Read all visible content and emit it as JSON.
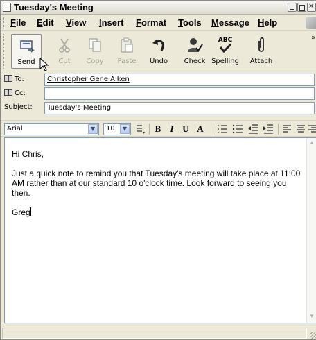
{
  "window": {
    "title": "Tuesday's Meeting"
  },
  "menu": [
    {
      "label": "File"
    },
    {
      "label": "Edit"
    },
    {
      "label": "View"
    },
    {
      "label": "Insert"
    },
    {
      "label": "Format"
    },
    {
      "label": "Tools"
    },
    {
      "label": "Message"
    },
    {
      "label": "Help"
    }
  ],
  "toolbar": {
    "send": "Send",
    "cut": "Cut",
    "copy": "Copy",
    "paste": "Paste",
    "undo": "Undo",
    "check": "Check",
    "spelling": "Spelling",
    "spelling_icon_text": "ABC",
    "attach": "Attach",
    "overflow": "»"
  },
  "header": {
    "to_label": "To:",
    "to_value": "Christopher Gene Aiken",
    "cc_label": "Cc:",
    "cc_value": "",
    "subject_label": "Subject:",
    "subject_value": "Tuesday's Meeting"
  },
  "format": {
    "font": "Arial",
    "size": "10",
    "bold": "B",
    "italic": "I",
    "underline": "U",
    "color": "A"
  },
  "message": {
    "greeting": "Hi Chris,",
    "body": "Just a quick note to remind you that Tuesday's meeting will take place at 11:00 AM rather than at our standard 10 o'clock time. Look forward to seeing you then.",
    "signature": "Greg"
  },
  "colors": {
    "chrome": "#ece9d8",
    "field_border": "#7f9db9"
  }
}
